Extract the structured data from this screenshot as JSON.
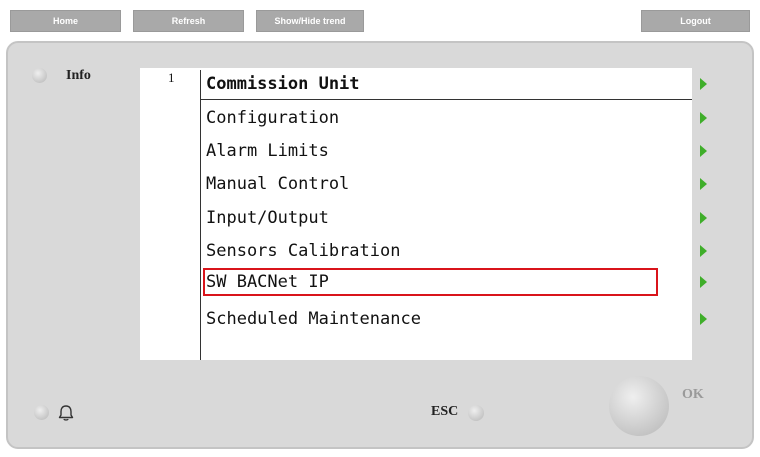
{
  "topbar": {
    "home": "Home",
    "refresh": "Refresh",
    "show_hide_trend": "Show/Hide trend",
    "logout": "Logout"
  },
  "panel": {
    "info_label": "Info",
    "esc_label": "ESC",
    "ok_label": "OK"
  },
  "screen": {
    "page_number": "1",
    "title": "Commission Unit",
    "items": [
      "Configuration",
      "Alarm Limits",
      "Manual Control",
      "Input/Output",
      "Sensors Calibration",
      "SW BACNet IP",
      "Scheduled Maintenance"
    ],
    "highlighted_item": "SW BACNet IP"
  },
  "colors": {
    "arrow": "#3fae2a",
    "highlight": "#d9141b",
    "panel": "#d9d9d9",
    "top_button": "#a9a9a9"
  },
  "icons": {
    "info_led": "led-indicator-icon",
    "alarm": "bell-icon",
    "row_arrow": "green-play-arrow-icon"
  }
}
